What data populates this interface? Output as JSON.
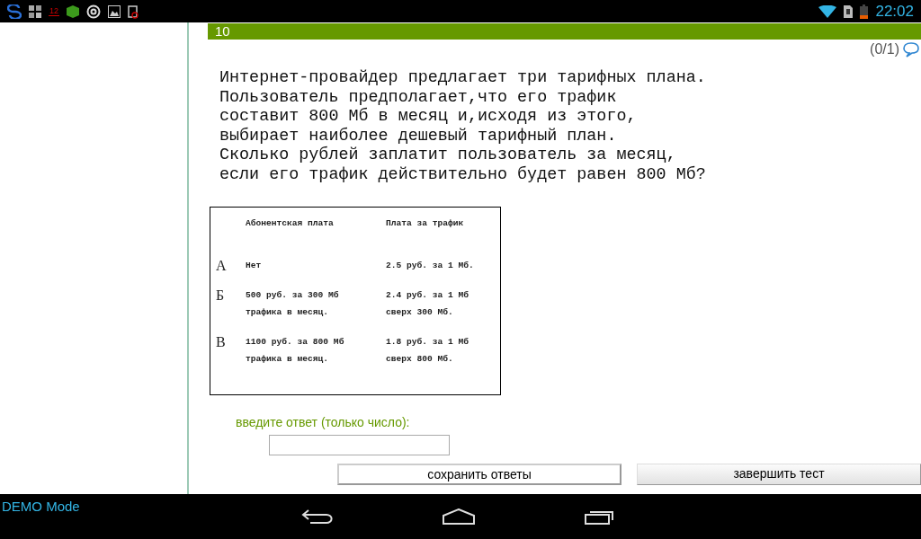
{
  "status_bar": {
    "notification_count": "12",
    "time": "22:02"
  },
  "question": {
    "number": "10",
    "score": "(0/1)",
    "text": "Интернет-провайдер предлагает три тарифных плана.\nПользователь предполагает,что его трафик\nсоставит 800 Мб в месяц и,исходя из этого,\nвыбирает наиболее дешевый тарифный план.\nСколько рублей заплатит пользователь за месяц,\nесли его трафик действительно будет равен 800 Мб?",
    "table": {
      "columns": [
        "Абонентская плата",
        "Плата за трафик"
      ],
      "rows": [
        {
          "label": "А",
          "fee": "Нет",
          "traffic": "2.5 руб. за 1 Мб."
        },
        {
          "label": "Б",
          "fee": "500 руб. за 300 Мб\nтрафика в месяц.",
          "traffic": "2.4 руб. за 1 Мб\nсверх 300 Мб."
        },
        {
          "label": "В",
          "fee": "1100 руб. за 800 Мб\nтрафика в месяц.",
          "traffic": "1.8 руб. за 1 Мб\nсверх 800 Мб."
        }
      ]
    }
  },
  "answer": {
    "label": "введите ответ (только число):"
  },
  "buttons": [
    "сохранить ответы",
    "завершить тест"
  ],
  "footer": {
    "mode": "DEMO Mode"
  }
}
